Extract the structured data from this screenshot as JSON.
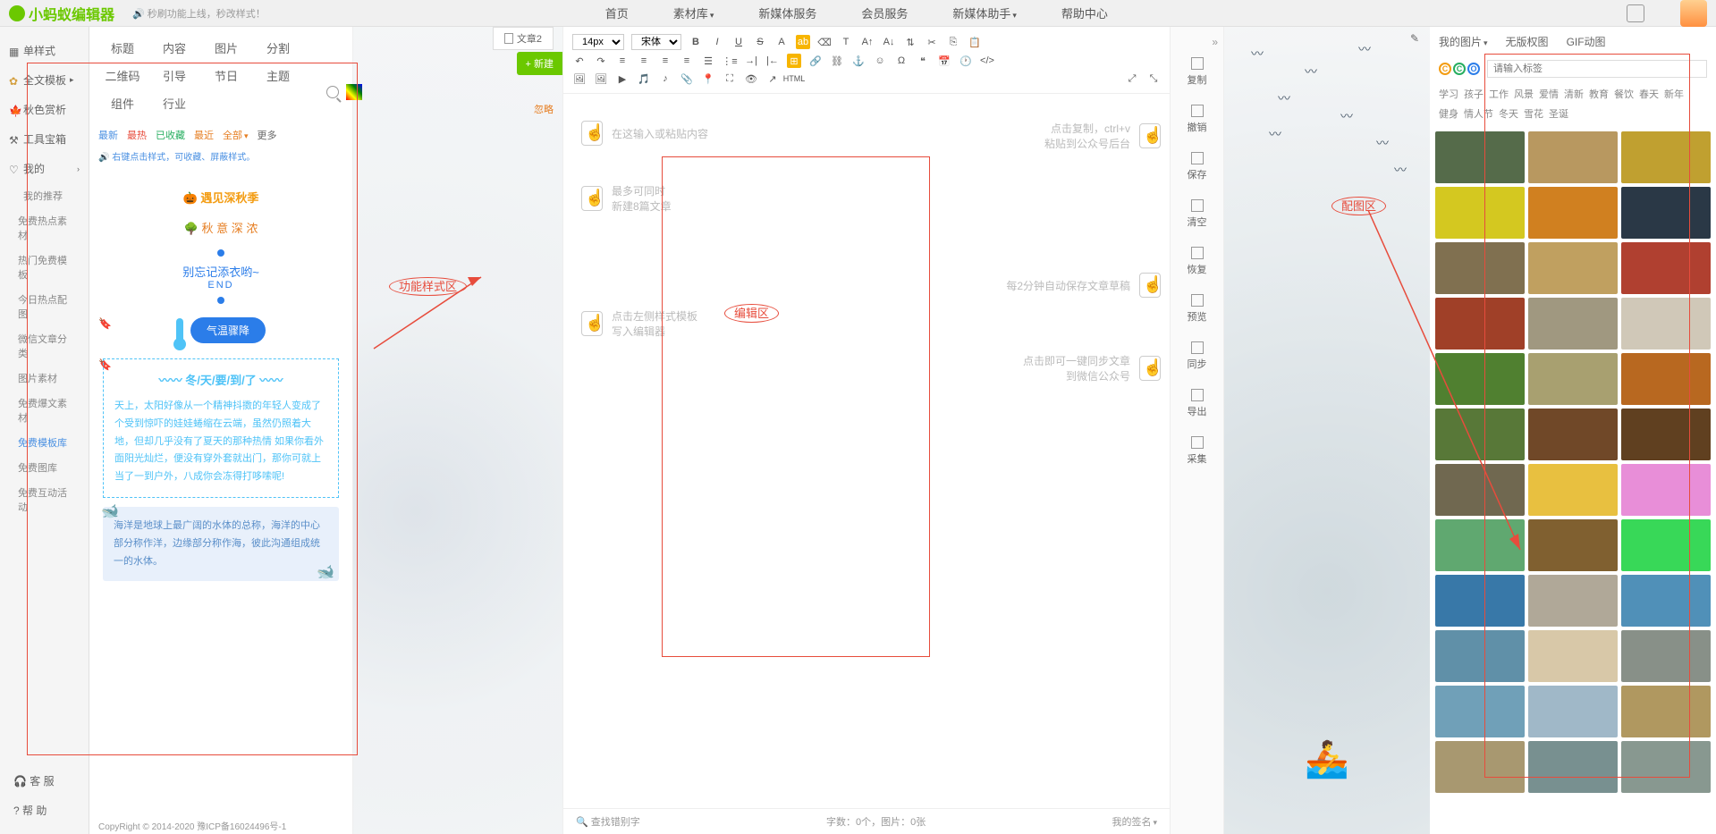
{
  "logo": "小蚂蚁编辑器",
  "announce": "🔊 秒刷功能上线，秒改样式！",
  "nav": [
    "首页",
    "素材库",
    "新媒体服务",
    "会员服务",
    "新媒体助手",
    "帮助中心"
  ],
  "sidebar": {
    "items": [
      {
        "label": "单样式"
      },
      {
        "label": "全文模板"
      },
      {
        "label": "秋色赏析"
      },
      {
        "label": "工具宝箱"
      },
      {
        "label": "我的"
      }
    ],
    "subs": [
      "我的推荐",
      "免费热点素材",
      "热门免费模板",
      "今日热点配图",
      "微信文章分类",
      "图片素材",
      "免费爆文素材",
      "免费模板库",
      "免费图库",
      "免费互动活动"
    ],
    "activeSub": "免费模板库",
    "bottom": [
      "客 服",
      "帮 助"
    ]
  },
  "cats": {
    "row1": [
      "标题",
      "内容",
      "图片",
      "分割",
      "二维码"
    ],
    "row2": [
      "引导",
      "节日",
      "主题",
      "组件",
      "行业"
    ]
  },
  "filters": {
    "new": "最新",
    "hot": "最热",
    "fav": "已收藏",
    "recent": "最近",
    "all": "全部",
    "more": "更多"
  },
  "tip": "🔊 右键点击样式，可收藏、屏蔽样式。",
  "miss": "忽略",
  "styles": {
    "s1": "遇见深秋季",
    "s2": "秋 意 深 浓",
    "s3": "别忘记添衣哟~",
    "s3b": "END",
    "s4": "气温骤降",
    "winterTitle": "冬/天/要/到/了",
    "winterBody": "天上，太阳好像从一个精神抖擞的年轻人变成了个受到惊吓的娃娃蜷缩在云端，虽然仍照着大地，但却几乎没有了夏天的那种热情 如果你看外面阳光灿烂，便没有穿外套就出门，那你可就上当了一到户外，八成你会冻得打哆嗦呢!",
    "ocean": "海洋是地球上最广阔的水体的总称，海洋的中心部分称作洋，边缘部分称作海，彼此沟通组成统一的水体。"
  },
  "docTab": "文章2",
  "newBtn": "+ 新建",
  "toolbar": {
    "size": "14px",
    "font": "宋体",
    "html": "HTML"
  },
  "hints": {
    "h1": "在这输入或粘贴内容",
    "h1b": "点击复制，ctrl+v\n粘贴到公众号后台",
    "h2": "最多可同时\n新建8篇文章",
    "h3": "每2分钟自动保存文章草稿",
    "h4": "点击左侧样式模板\n写入编辑器",
    "h5": "点击即可一键同步文章\n到微信公众号"
  },
  "edFooter": {
    "find": "查找错别字",
    "count": "字数：0个，图片：0张",
    "sign": "我的签名"
  },
  "rightTools": [
    "复制",
    "撤销",
    "保存",
    "清空",
    "恢复",
    "预览",
    "同步",
    "导出",
    "采集"
  ],
  "imgTabs": [
    "我的图片",
    "无版权图",
    "GIF动图"
  ],
  "tagPlaceholder": "请输入标签",
  "tags": [
    "学习",
    "孩子",
    "工作",
    "风景",
    "爱情",
    "清新",
    "教育",
    "餐饮",
    "春天",
    "新年",
    "健身",
    "情人节",
    "冬天",
    "雪花",
    "圣诞"
  ],
  "annotations": {
    "a1": "功能样式区",
    "a2": "编辑区",
    "a3": "配图区"
  },
  "thumbs": [
    "#556b4a",
    "#b89860",
    "#c0a030",
    "#d4c820",
    "#d08020",
    "#2a3846",
    "#807050",
    "#c0a060",
    "#b04030",
    "#a04028",
    "#a09880",
    "#d0c8b8",
    "#508030",
    "#a8a070",
    "#b86820",
    "#587838",
    "#704828",
    "#604020",
    "#706850",
    "#e8c040",
    "#e88ed8",
    "#60a870",
    "#806030",
    "#38d858",
    "#3878a8",
    "#b0a898",
    "#5090b8",
    "#6090a8",
    "#d8c8a8",
    "#889088",
    "#70a0b8",
    "#a0b8c8",
    "#b09860",
    "#a89870",
    "#789090",
    "#889890"
  ],
  "copyright": "CopyRight © 2014-2020 豫ICP备16024496号-1"
}
